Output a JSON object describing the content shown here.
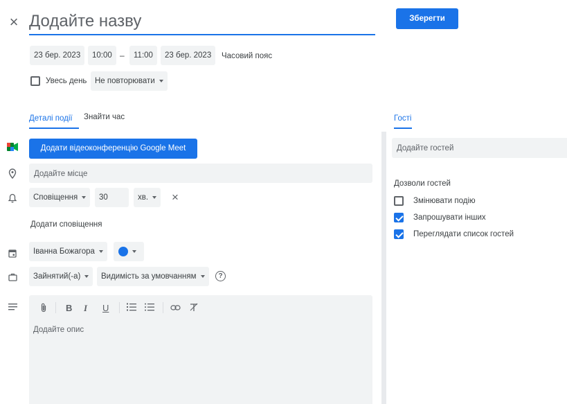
{
  "header": {
    "close_icon": "close-icon",
    "title_placeholder": "Додайте назву",
    "save_label": "Зберегти"
  },
  "datetime": {
    "start_date": "23 бер. 2023",
    "start_time": "10:00",
    "dash": "–",
    "end_time": "11:00",
    "end_date": "23 бер. 2023",
    "timezone_label": "Часовий пояс",
    "all_day_label": "Увесь день",
    "all_day_checked": false,
    "repeat_value": "Не повторювати"
  },
  "tabs": {
    "details": "Деталі події",
    "find_time": "Знайти час",
    "guests": "Гості"
  },
  "details": {
    "meet_button": "Додати відеоконференцію Google Meet",
    "location_placeholder": "Додайте місце",
    "notification_type": "Сповіщення",
    "notification_value": "30",
    "notification_unit": "хв.",
    "add_notification": "Додати сповіщення",
    "calendar_owner": "Іванна Божагора",
    "calendar_color": "#1a73e8",
    "busy_status": "Зайнятий(-а)",
    "visibility": "Видимість за умовчанням",
    "description_placeholder": "Додайте опис"
  },
  "guests": {
    "add_placeholder": "Додайте гостей",
    "permissions_title": "Дозволи гостей",
    "permissions": [
      {
        "label": "Змінювати подію",
        "checked": false
      },
      {
        "label": "Запрошувати інших",
        "checked": true
      },
      {
        "label": "Переглядати список гостей",
        "checked": true
      }
    ]
  },
  "colors": {
    "accent": "#1a73e8",
    "field_bg": "#f1f3f4"
  }
}
